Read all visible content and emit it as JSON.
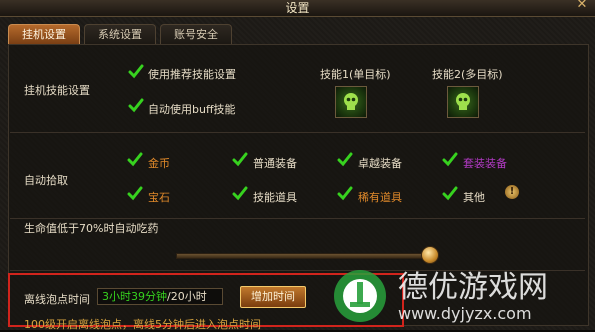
{
  "window": {
    "title": "设置"
  },
  "tabs": [
    {
      "label": "挂机设置",
      "active": true
    },
    {
      "label": "系统设置",
      "active": false
    },
    {
      "label": "账号安全",
      "active": false
    }
  ],
  "skills": {
    "section_label": "挂机技能设置",
    "opt_recommended": "使用推荐技能设置",
    "opt_auto_buff": "自动使用buff技能",
    "skill1_label": "技能1(单目标)",
    "skill2_label": "技能2(多目标)"
  },
  "pickup": {
    "section_label": "自动拾取",
    "items": [
      {
        "label": "金币",
        "color": "#e0892a"
      },
      {
        "label": "普通装备",
        "color": "#e6dcc6"
      },
      {
        "label": "卓越装备",
        "color": "#e6dcc6"
      },
      {
        "label": "套装装备",
        "color": "#b23ac4"
      },
      {
        "label": "宝石",
        "color": "#e0892a"
      },
      {
        "label": "技能道具",
        "color": "#e6dcc6"
      },
      {
        "label": "稀有道具",
        "color": "#e0892a"
      },
      {
        "label": "其他",
        "color": "#e6dcc6"
      }
    ]
  },
  "potion": {
    "label": "生命值低于70%时自动吃药",
    "threshold_percent": 70
  },
  "offline": {
    "label": "离线泡点时间",
    "time_used": "3小时39分钟",
    "time_sep": "/",
    "time_total": "20小时",
    "add_button": "增加时间",
    "note": "100级开启离线泡点，离线5分钟后进入泡点时间"
  },
  "watermark": {
    "text": "德优游戏网",
    "url": "www.dyjyzx.com"
  },
  "colors": {
    "accent": "#c46a22",
    "check": "#37d21f",
    "highlight_box": "#d1241c"
  }
}
